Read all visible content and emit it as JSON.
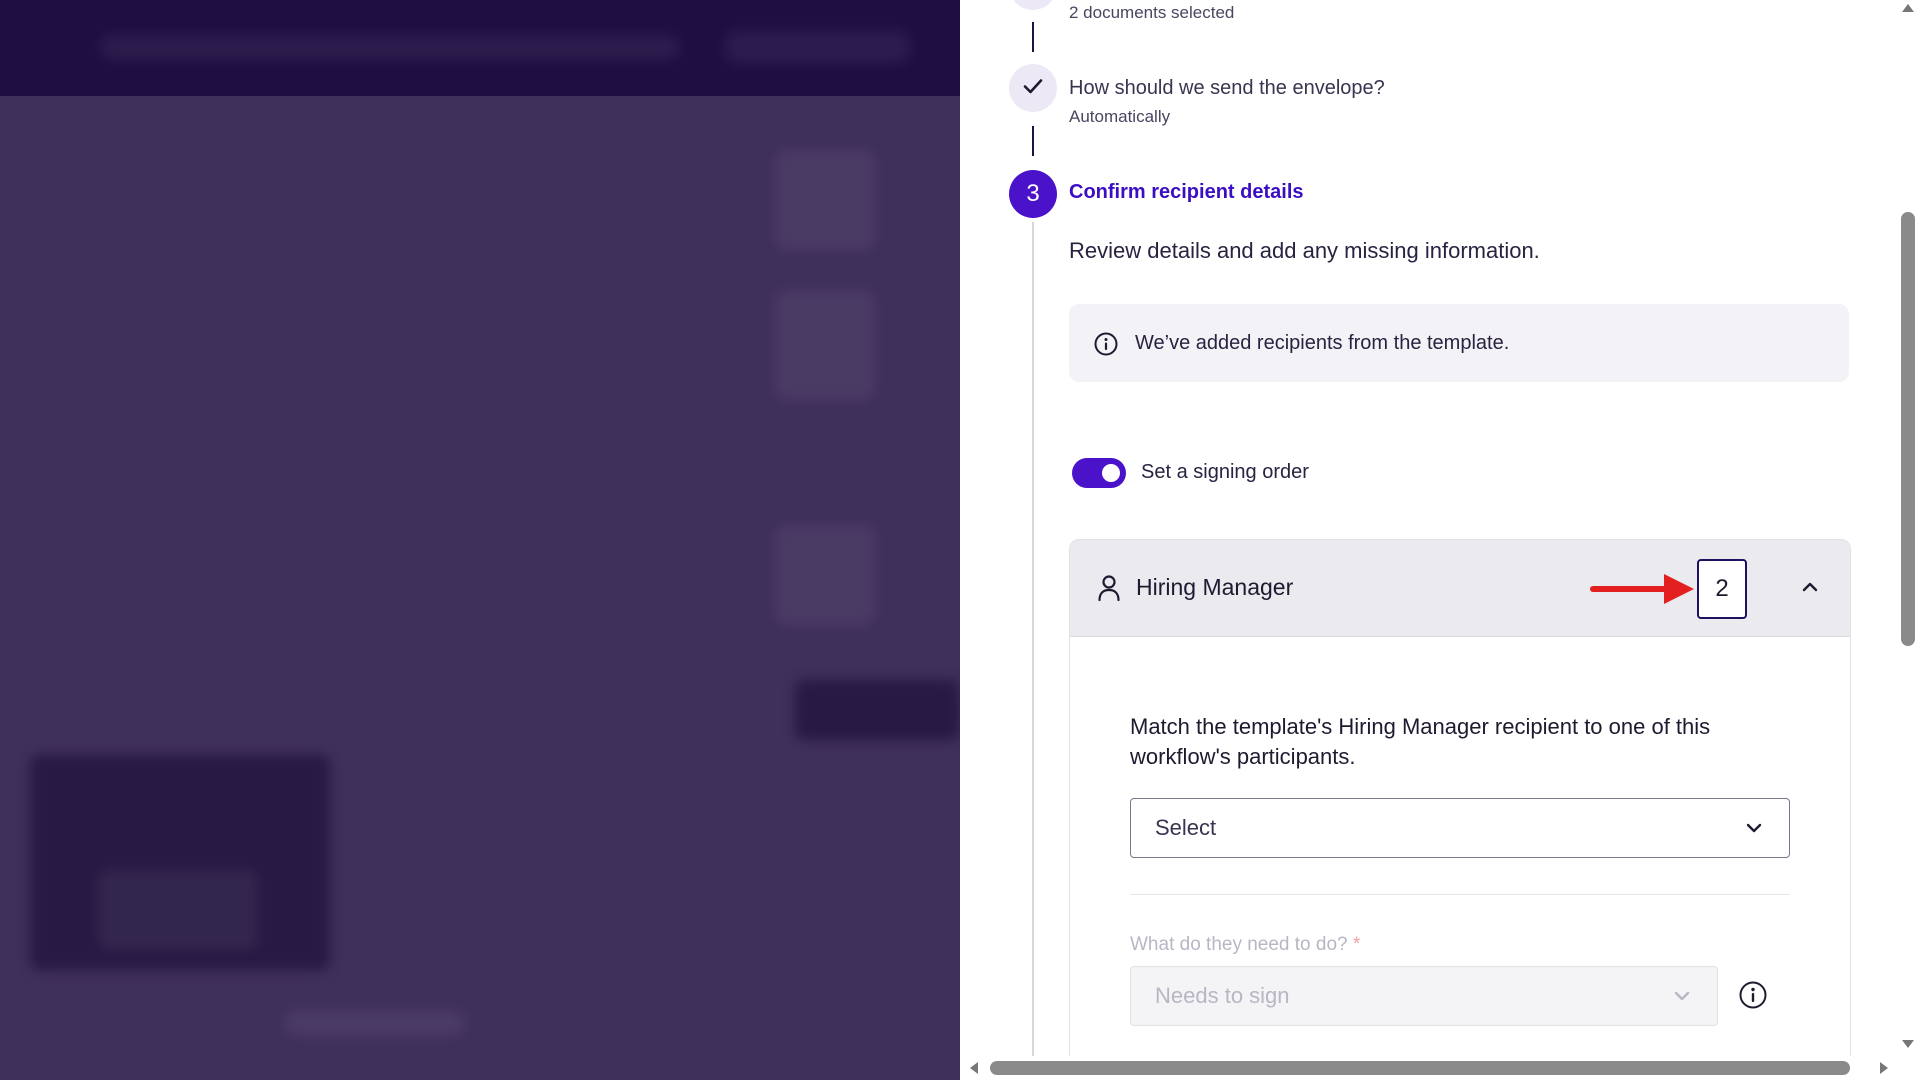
{
  "steps": {
    "step1": {
      "summary": "2 documents selected"
    },
    "step2": {
      "title": "How should we send the envelope?",
      "summary": "Automatically"
    },
    "step3": {
      "number": "3",
      "title": "Confirm recipient details",
      "description": "Review details and add any missing information.",
      "info": "We’ve added recipients from the template.",
      "toggle_label": "Set a signing order"
    }
  },
  "recipient_card": {
    "role": "Hiring Manager",
    "order": "2",
    "match_text": "Match the template's Hiring Manager recipient to one of this workflow's participants.",
    "select_value": "Select",
    "action_label": "What do they need to do?",
    "required_mark": "*",
    "action_value": "Needs to sign"
  },
  "colors": {
    "accent": "#4a12c9",
    "annotation_arrow": "#e41f1f",
    "overlay": "#3f2f5b"
  }
}
